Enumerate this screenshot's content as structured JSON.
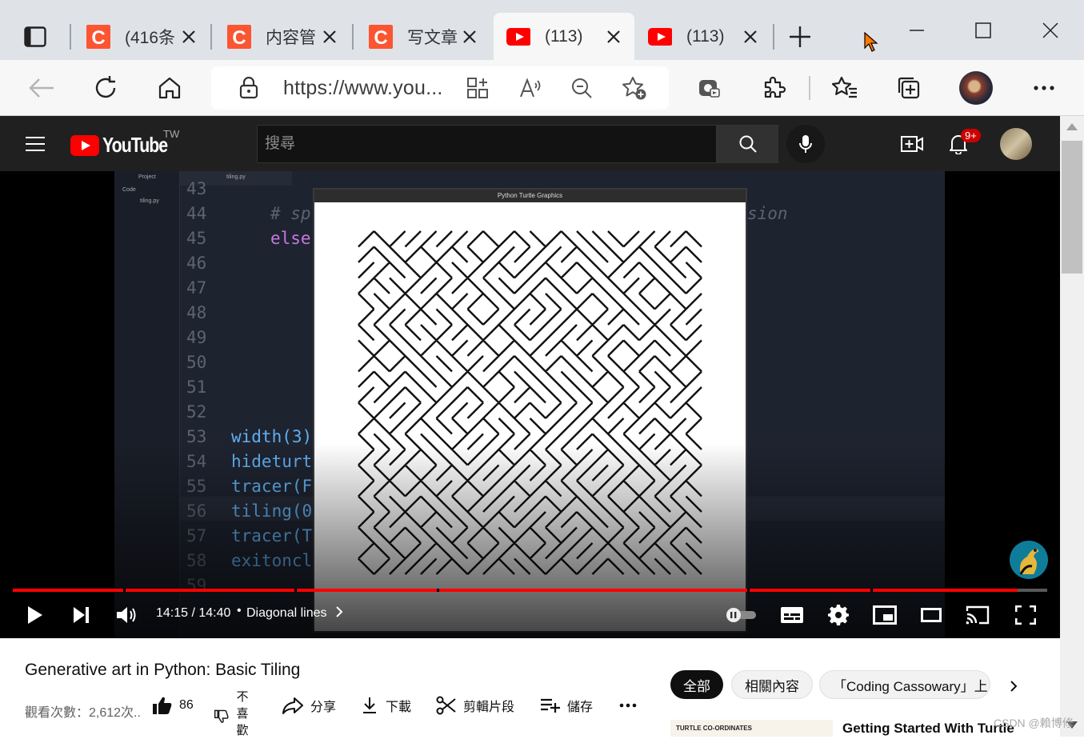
{
  "browser": {
    "tabs": [
      {
        "title": "(416条",
        "favicon": "csdn-icon",
        "active": false
      },
      {
        "title": "内容管",
        "favicon": "csdn-icon",
        "active": false
      },
      {
        "title": "写文章",
        "favicon": "csdn-icon",
        "active": false
      },
      {
        "title": "(113)",
        "favicon": "youtube-icon",
        "active": true
      },
      {
        "title": "(113)",
        "favicon": "youtube-icon",
        "active": false
      }
    ],
    "address_bar": {
      "url": "https://www.you..."
    },
    "colors": {
      "csdn": "#fc5531",
      "youtube_red": "#ff0000"
    }
  },
  "youtube": {
    "logo_text": "YouTube",
    "region": "TW",
    "search_placeholder": "搜尋",
    "notification_count": "9+"
  },
  "video": {
    "code_lines": [
      {
        "n": "43",
        "code": ""
      },
      {
        "n": "44",
        "code": "# sp",
        "tail": "sion"
      },
      {
        "n": "45",
        "code": "else"
      },
      {
        "n": "46",
        "code": ""
      },
      {
        "n": "47",
        "code": ""
      },
      {
        "n": "48",
        "code": ""
      },
      {
        "n": "49",
        "code": ""
      },
      {
        "n": "50",
        "code": ""
      },
      {
        "n": "51",
        "code": ""
      },
      {
        "n": "52",
        "code": ""
      },
      {
        "n": "53",
        "code": "width(3)"
      },
      {
        "n": "54",
        "code": "hideturt"
      },
      {
        "n": "55",
        "code": "tracer(F"
      },
      {
        "n": "56",
        "code": "tiling(0"
      },
      {
        "n": "57",
        "code": "tracer(T"
      },
      {
        "n": "58",
        "code": "exitoncl"
      },
      {
        "n": "59",
        "code": ""
      }
    ],
    "ide_project_label": "Project",
    "ide_folder_label": "Code",
    "ide_file_label": "tiling.py",
    "ide_tab_label": "tiling.py",
    "turtle_window_title": "Python Turtle Graphics",
    "player": {
      "time_current": "14:15",
      "time_total": "14:40",
      "time_display": "14:15 / 14:40",
      "chapter_title": "Diagonal lines",
      "progress": 0.971,
      "chapters": [
        0.107,
        0.272,
        0.41,
        0.71,
        0.829
      ]
    },
    "title": "Generative art in Python: Basic Tiling",
    "views": "觀看次數：2,612次..",
    "likes": "86",
    "dislike_label": "不喜歡",
    "actions": {
      "share": "分享",
      "download": "下載",
      "clip": "剪輯片段",
      "save": "儲存"
    },
    "chips": [
      "全部",
      "相關內容",
      "「Coding Cassowary」上"
    ],
    "recommendation": {
      "thumb_text": "TURTLE CO-ORDINATES",
      "title": "Getting Started With Turtle"
    }
  },
  "watermark": "CSDN @賴博修"
}
